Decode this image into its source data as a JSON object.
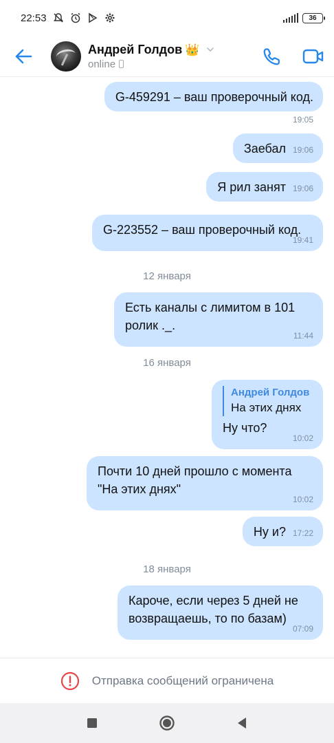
{
  "status_bar": {
    "time": "22:53",
    "battery": "36",
    "icons": [
      "muted-bell-icon",
      "alarm-icon",
      "play-store-icon",
      "gear-icon",
      "signal-icon",
      "battery-icon"
    ]
  },
  "header": {
    "contact_name": "Андрей Голдов",
    "crown": "👑",
    "status": "online",
    "icons": [
      "back-arrow-icon",
      "phone-icon",
      "video-camera-icon"
    ],
    "accent_color": "#2688eb"
  },
  "messages": [
    {
      "text": "G-459291 – ваш проверочный код.",
      "time": "19:05"
    },
    {
      "text": "Заебал",
      "time": "19:06"
    },
    {
      "text": "Я рил занят",
      "time": "19:06"
    },
    {
      "text": "G-223552 – ваш проверочный код.",
      "time": "19:41"
    },
    {
      "date": "12 января"
    },
    {
      "text": "Есть каналы с лимитом в 101\nролик ._.",
      "time": "11:44"
    },
    {
      "date": "16 января"
    },
    {
      "reply_author": "Андрей Голдов",
      "reply_text": "На этих днях",
      "text": "Ну что?",
      "time": "10:02"
    },
    {
      "text": "Почти 10 дней прошло с момента\n\"На этих днях\"",
      "time": "10:02"
    },
    {
      "text": "Ну и?",
      "time": "17:22"
    },
    {
      "date": "18 января"
    },
    {
      "text": "Кароче, если через 5 дней не\nвозвращаешь, то по базам)",
      "time": "07:09"
    }
  ],
  "restricted_notice": "Отправка сообщений ограничена",
  "colors": {
    "bubble": "#cce4ff",
    "warning": "#e64646",
    "muted_text": "#818c99"
  }
}
